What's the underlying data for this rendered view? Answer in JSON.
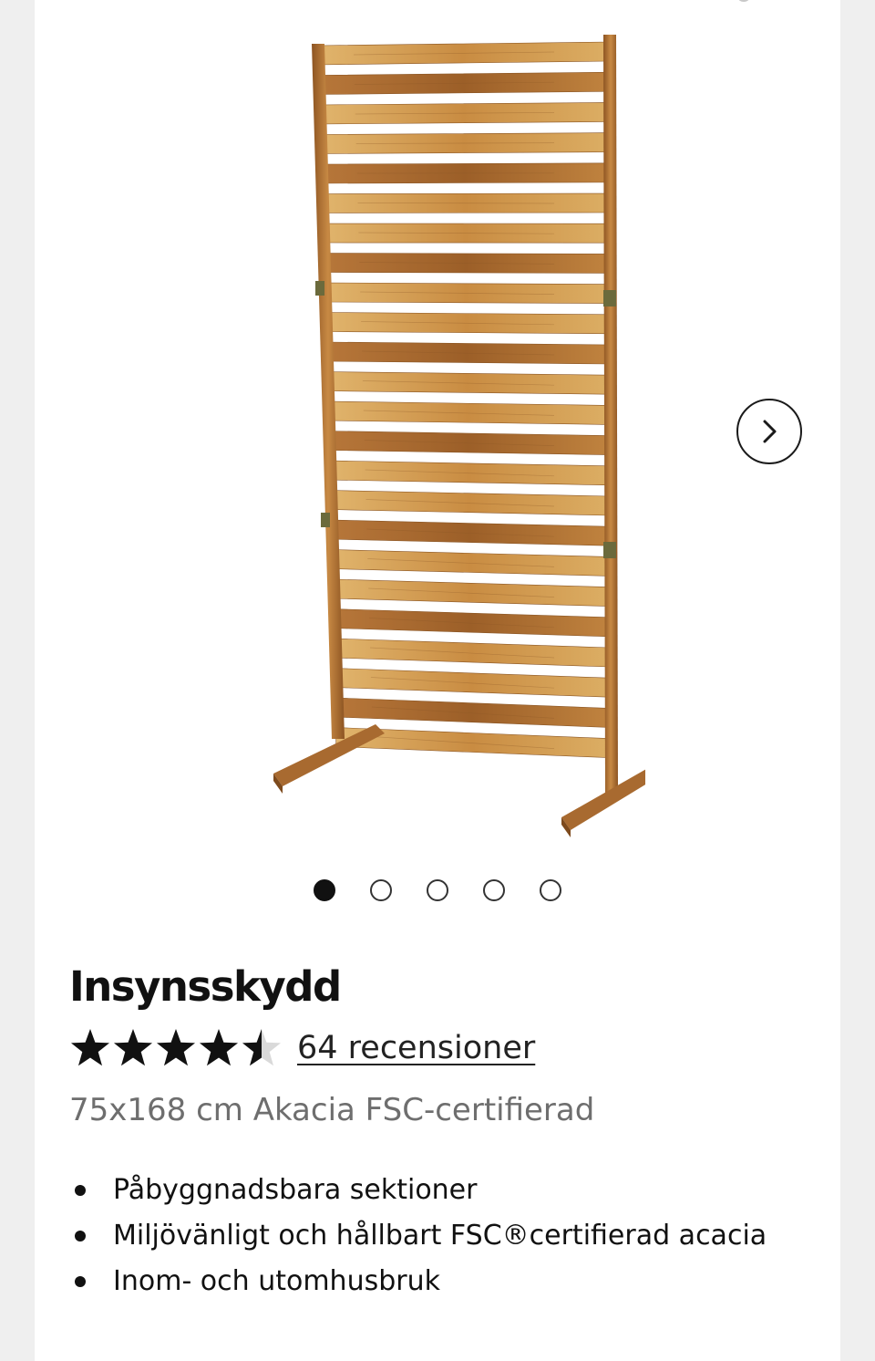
{
  "product": {
    "title": "Insynsskydd",
    "rating": 4.5,
    "rating_max": 5,
    "reviews_label": "64 recensioner",
    "subtitle": "75x168 cm Akacia FSC-certifierad",
    "features": [
      "Påbyggnadsbara sektioner",
      "Miljövänligt och hållbart FSC®certifierad acacia",
      "Inom- och utomhusbruk"
    ]
  },
  "gallery": {
    "image_count": 5,
    "active_index": 0,
    "next_icon": "chevron-right-icon"
  },
  "colors": {
    "star": "#111111",
    "star_empty": "#d9d9d9",
    "wood_light": "#d9a85c",
    "wood_dark": "#a9692e"
  }
}
